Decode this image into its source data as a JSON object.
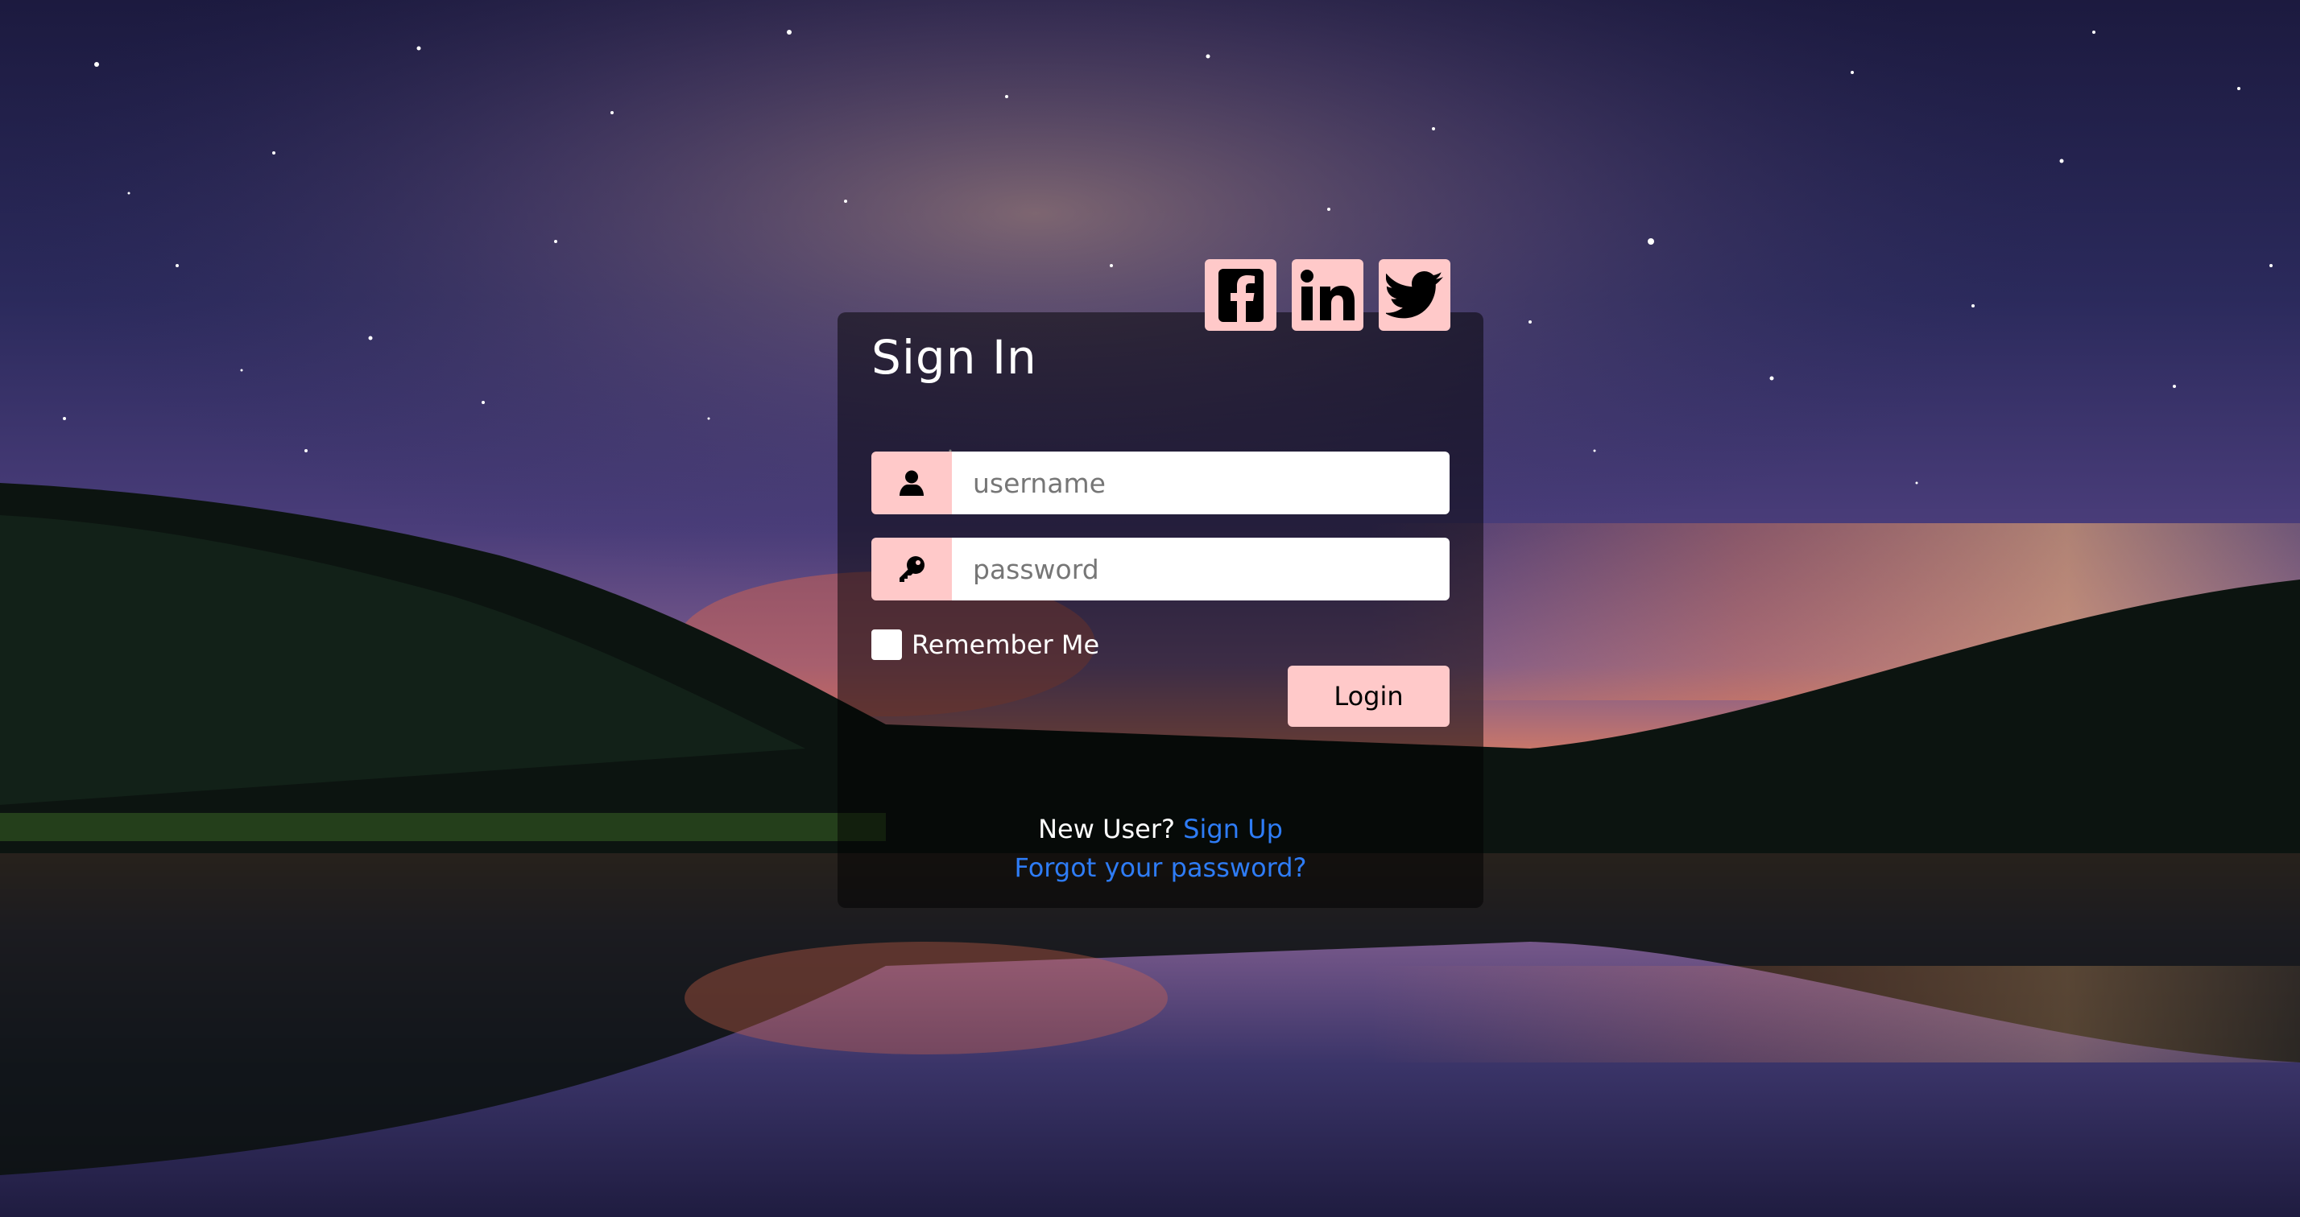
{
  "form": {
    "title": "Sign In",
    "username_placeholder": "username",
    "password_placeholder": "password",
    "remember_label": "Remember Me",
    "login_label": "Login",
    "new_user_text": "New User?",
    "signup_label": "Sign Up",
    "forgot_label": "Forgot your password?"
  },
  "socials": [
    {
      "name": "facebook-icon"
    },
    {
      "name": "linkedin-icon"
    },
    {
      "name": "twitter-icon"
    }
  ],
  "colors": {
    "accent": "#ffc9c9",
    "link": "#2e7cf6",
    "card_overlay": "rgba(0,0,0,0.5)"
  }
}
